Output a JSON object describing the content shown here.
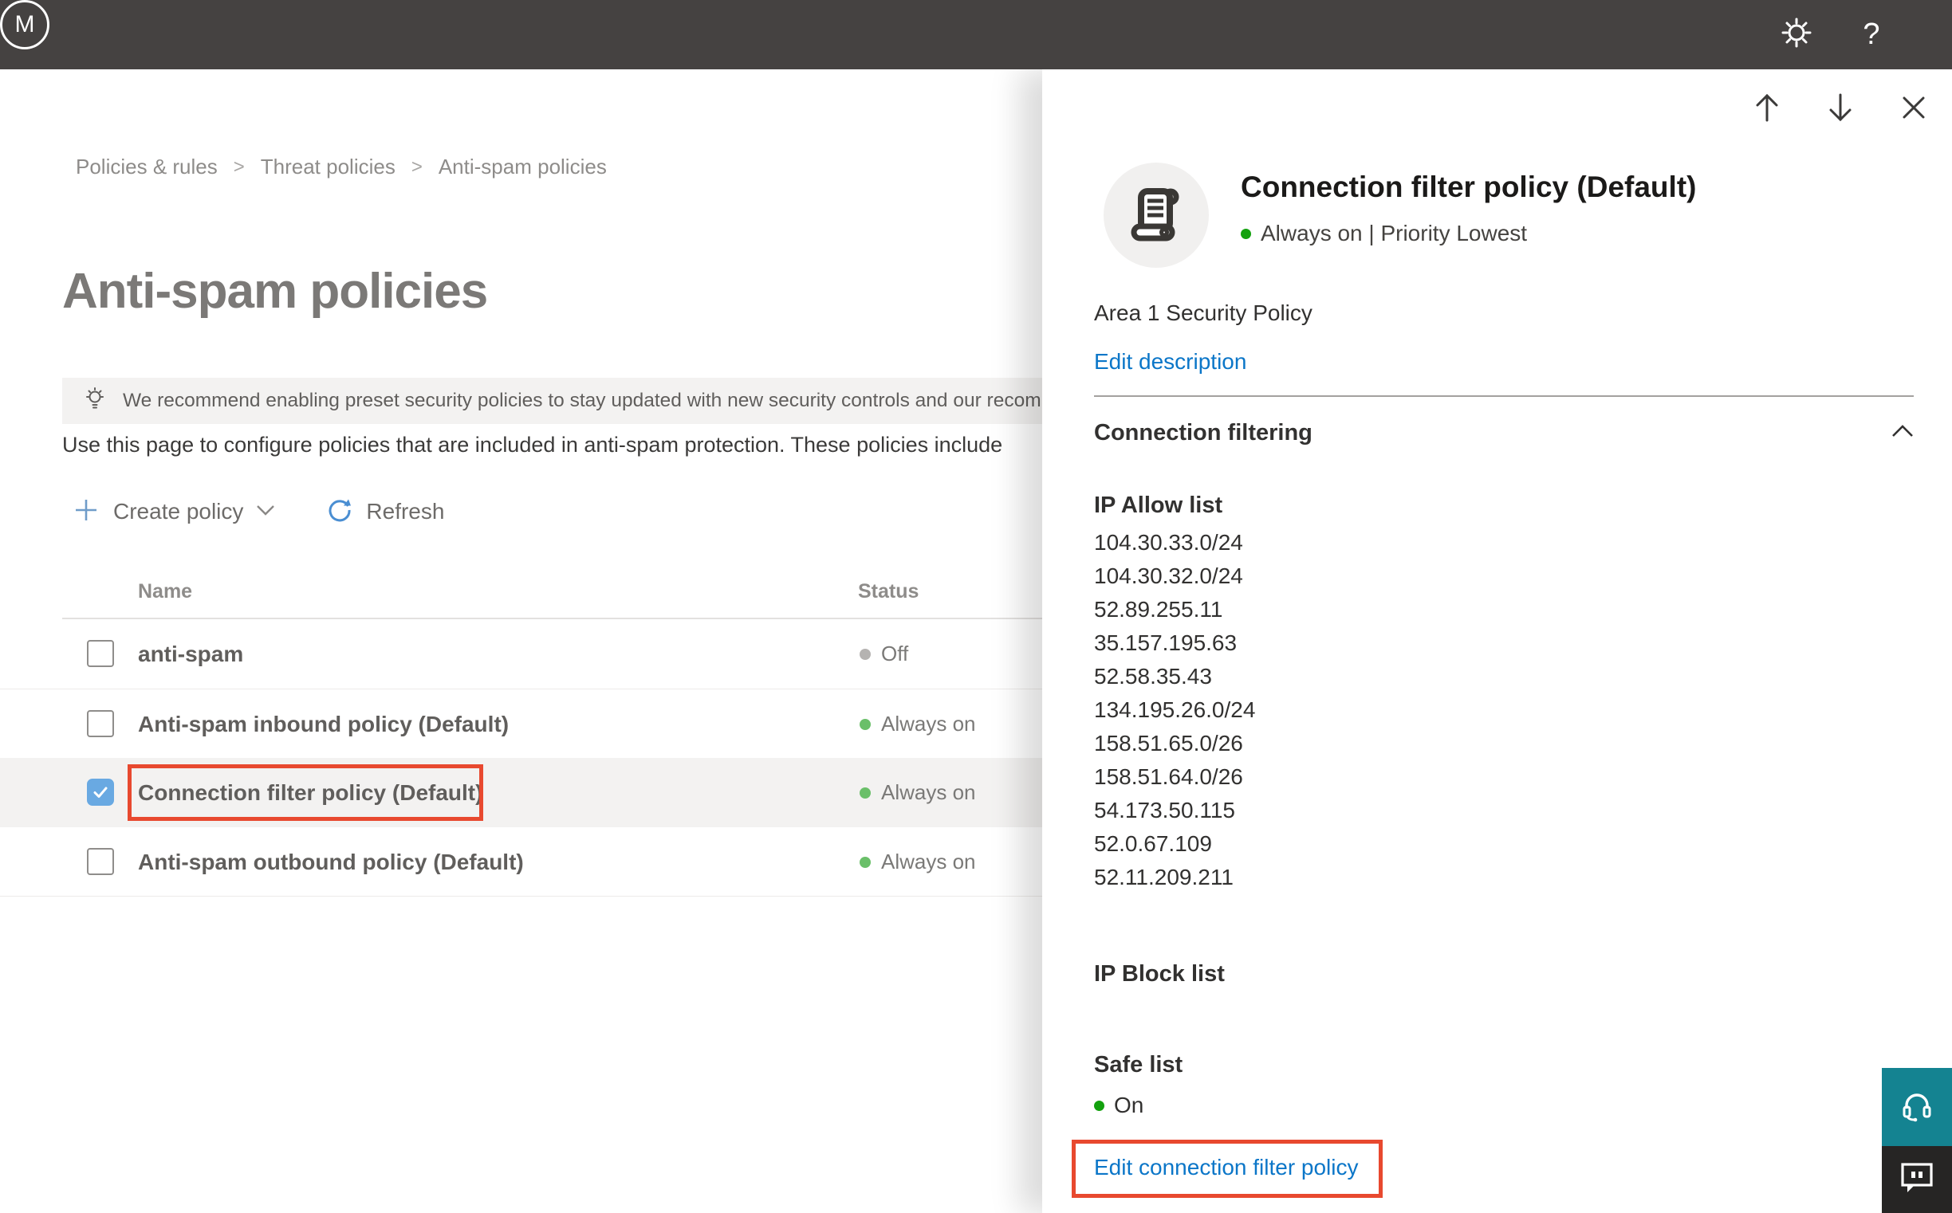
{
  "topbar": {
    "help_label": "?",
    "avatar_initial": "M"
  },
  "breadcrumb": {
    "items": [
      "Policies & rules",
      "Threat policies",
      "Anti-spam policies"
    ],
    "separator": ">"
  },
  "page": {
    "title": "Anti-spam policies",
    "banner_text": "We recommend enabling preset security policies to stay updated with new security controls and our recomme",
    "description": "Use this page to configure policies that are included in anti-spam protection. These policies include"
  },
  "toolbar": {
    "create_label": "Create policy",
    "refresh_label": "Refresh"
  },
  "table": {
    "columns": {
      "name": "Name",
      "status": "Status"
    },
    "rows": [
      {
        "name": "anti-spam",
        "status": "Off",
        "checked": false
      },
      {
        "name": "Anti-spam inbound policy (Default)",
        "status": "Always on",
        "checked": false
      },
      {
        "name": "Connection filter policy (Default)",
        "status": "Always on",
        "checked": true
      },
      {
        "name": "Anti-spam outbound policy (Default)",
        "status": "Always on",
        "checked": false
      }
    ]
  },
  "panel": {
    "title": "Connection filter policy (Default)",
    "status_line": "Always on | Priority Lowest",
    "description": "Area 1 Security Policy",
    "edit_description_label": "Edit description",
    "section_label": "Connection filtering",
    "ip_allow": {
      "label": "IP Allow list",
      "entries": [
        "104.30.33.0/24",
        "104.30.32.0/24",
        "52.89.255.11",
        "35.157.195.63",
        "52.58.35.43",
        "134.195.26.0/24",
        "158.51.65.0/26",
        "158.51.64.0/26",
        "54.173.50.115",
        "52.0.67.109",
        "52.11.209.211"
      ]
    },
    "ip_block_label": "IP Block list",
    "safe_list_label": "Safe list",
    "safe_list_value": "On",
    "edit_link_label": "Edit connection filter policy"
  },
  "colors": {
    "topbar_bg": "#454241",
    "banner_bg": "#f3f2f1",
    "highlight_row_bg": "#f3f2f1",
    "link_blue": "#0b76c8",
    "status_on_green": "#6abf69",
    "status_vivid_green": "#13a10e",
    "status_off_gray": "#b5b3b1",
    "checkbox_checked_blue": "#69a9e2",
    "annotation_red": "#e8492f",
    "helper_teal": "#148391",
    "helper_dark": "#262524"
  }
}
